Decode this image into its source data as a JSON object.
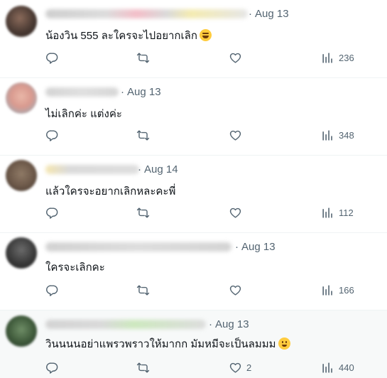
{
  "replies": [
    {
      "date": "Aug 13",
      "text": "น้องวิน 555 ละใครจะไปอยากเลิก",
      "emoji": "rolling-on-floor-laughing-emoji",
      "likes": "",
      "views": "236",
      "avatar_color": "#4a3a33"
    },
    {
      "date": "Aug 13",
      "text": "ไม่เลิกค่ะ แต่งค่ะ",
      "emoji": "",
      "likes": "",
      "views": "348",
      "avatar_color": "#d99a8f"
    },
    {
      "date": "Aug 14",
      "text": "แล้วใครจะอยากเลิกหละคะพี่",
      "emoji": "",
      "likes": "",
      "views": "112",
      "avatar_color": "#6b5748"
    },
    {
      "date": "Aug 13",
      "text": "ใครจะเลิกคะ",
      "emoji": "",
      "likes": "",
      "views": "166",
      "avatar_color": "#3a3a3a"
    },
    {
      "date": "Aug 13",
      "text": "วินนนนอย่าแพรวพราวให้มากก มัมหมีจะเป็นลมมม",
      "emoji": "hugging-face-emoji",
      "likes": "2",
      "views": "440",
      "avatar_color": "#3f5a3b"
    }
  ],
  "dot": "·",
  "colors": {
    "secondary_text": "#536471",
    "primary_text": "#0f1419",
    "divider": "#eff3f4",
    "highlight_bg": "#f7f9f9"
  },
  "icons": [
    "reply-icon",
    "retweet-icon",
    "like-icon",
    "views-icon"
  ]
}
